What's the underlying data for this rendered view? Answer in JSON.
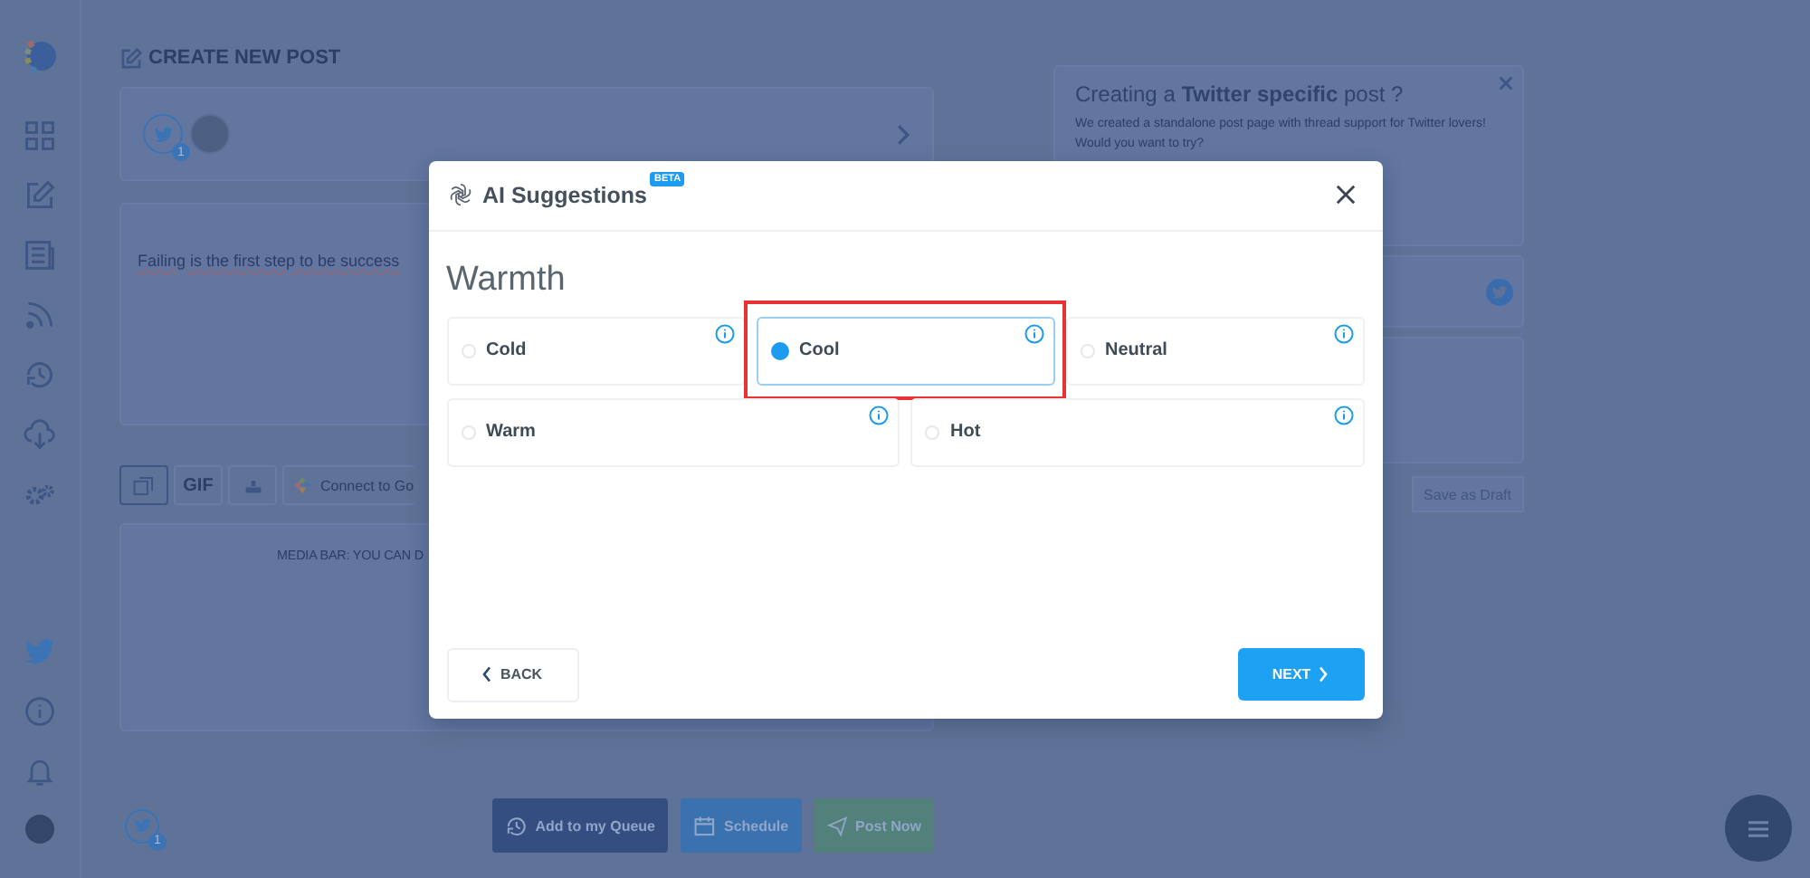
{
  "page": {
    "heading": "CREATE NEW POST",
    "account_badge": "1",
    "post_text": "Failing is the first step to be success",
    "media_tools": [
      {
        "kind": "image"
      },
      {
        "kind": "gif",
        "label": "GIF"
      },
      {
        "kind": "upload"
      },
      {
        "kind": "drive",
        "label": "Connect to Go"
      }
    ],
    "media_hint": "MEDIA BAR: YOU CAN D",
    "footer_badge": "1",
    "actions": [
      {
        "kind": "queue",
        "label": "Add to my Queue"
      },
      {
        "kind": "schedule",
        "label": "Schedule"
      },
      {
        "kind": "post",
        "label": "Post Now"
      }
    ],
    "promo": {
      "title": "Creating a **Twitter specific** post ?",
      "text": "We created a standalone post page with thread support for Twitter lovers! Would you want to try?"
    },
    "draft_button": "Save as Draft"
  },
  "sidebar": {
    "items": [
      {
        "kind": "grid"
      },
      {
        "kind": "edit"
      },
      {
        "kind": "news"
      },
      {
        "kind": "rss"
      },
      {
        "kind": "cycle"
      },
      {
        "kind": "cloud"
      },
      {
        "kind": "gears"
      }
    ],
    "bottom": [
      {
        "kind": "twitter"
      },
      {
        "kind": "info"
      },
      {
        "kind": "bell"
      },
      {
        "kind": "avatar"
      }
    ]
  },
  "modal": {
    "title": "AI Suggestions",
    "badge": "BETA",
    "section": "Warmth",
    "options": [
      {
        "label": "Cold",
        "selected": false,
        "highlighted": false
      },
      {
        "label": "Cool",
        "selected": true,
        "highlighted": true
      },
      {
        "label": "Neutral",
        "selected": false,
        "highlighted": false
      },
      {
        "label": "Warm",
        "selected": false,
        "highlighted": false
      },
      {
        "label": "Hot",
        "selected": false,
        "highlighted": false
      }
    ],
    "back": "BACK",
    "next": "NEXT"
  }
}
